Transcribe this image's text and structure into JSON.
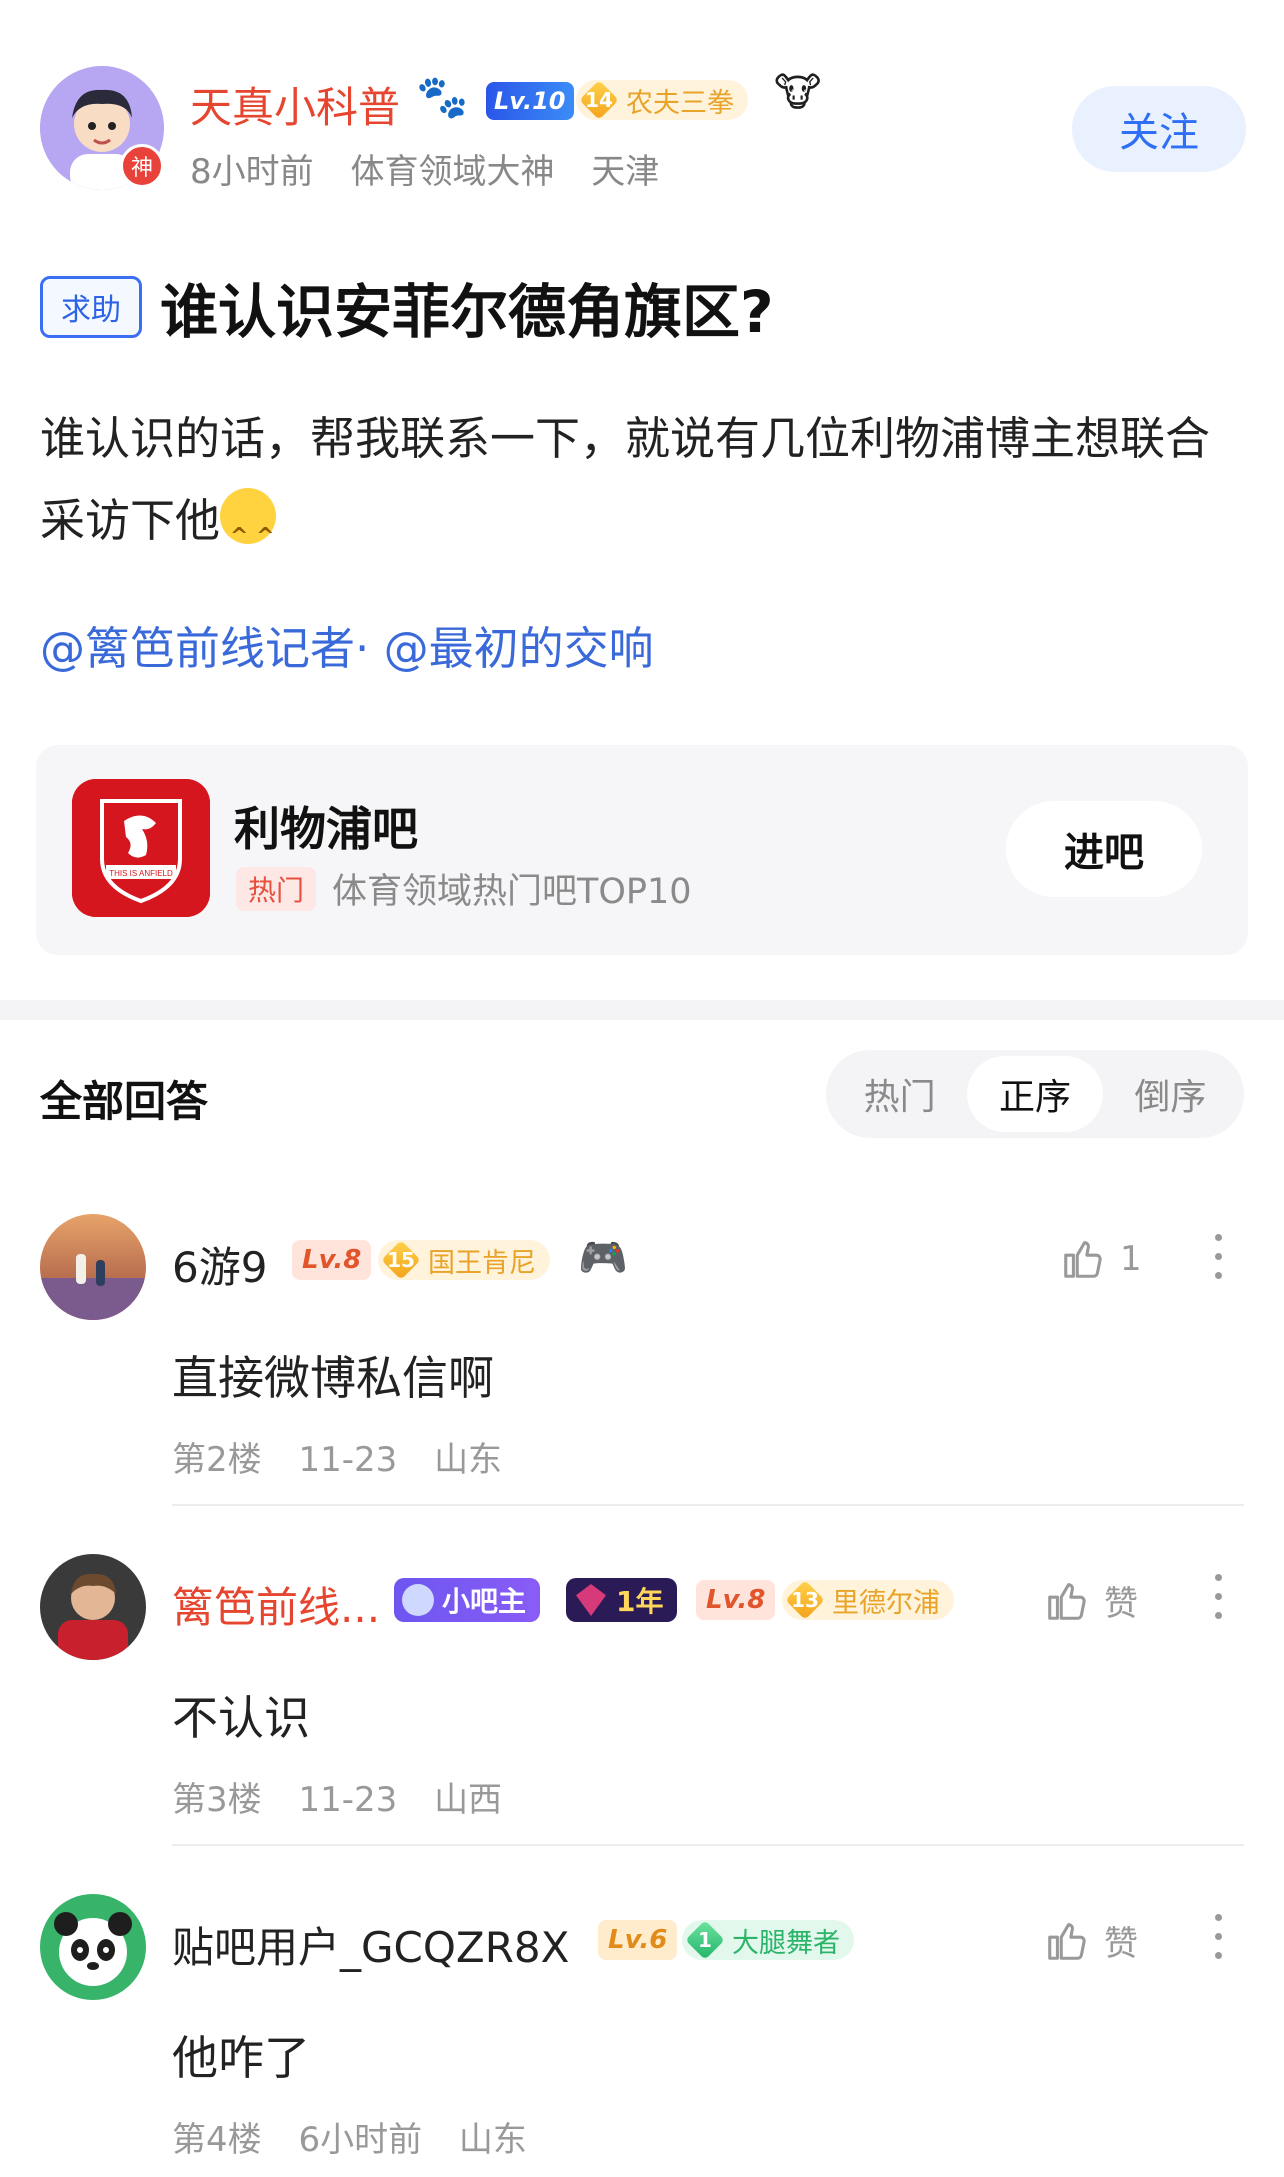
{
  "author": {
    "name": "天真小科普",
    "god_badge": "神",
    "level": "Lv.10",
    "honor": {
      "rank": "14",
      "title": "农夫三拳"
    },
    "meta": [
      "8小时前",
      "体育领域大神",
      "天津"
    ],
    "follow_label": "关注"
  },
  "post": {
    "tag": "求助",
    "title": "谁认识安菲尔德角旗区?",
    "body": "谁认识的话，帮我联系一下，就说有几位利物浦博主想联合采访下他",
    "mentions": "@篱笆前线记者· @最初的交响"
  },
  "forum": {
    "logo_text": "THIS IS ANFIELD",
    "name": "利物浦吧",
    "hot_tag": "热门",
    "desc": "体育领域热门吧TOP10",
    "enter_label": "进吧"
  },
  "answers": {
    "title": "全部回答",
    "sort_tabs": [
      "热门",
      "正序",
      "倒序"
    ],
    "active_sort": "正序"
  },
  "replies": [
    {
      "name": "6游9",
      "level": "Lv.8",
      "honor": {
        "rank": "15",
        "title": "国王肯尼"
      },
      "like": "1",
      "text": "直接微博私信啊",
      "meta": [
        "第2楼",
        "11-23",
        "山东"
      ]
    },
    {
      "name": "篱笆前线...",
      "bazhu": "小吧主",
      "year": "1年",
      "level": "Lv.8",
      "honor": {
        "rank": "13",
        "title": "里德尔浦"
      },
      "like": "赞",
      "text": "不认识",
      "meta": [
        "第3楼",
        "11-23",
        "山西"
      ]
    },
    {
      "name": "贴吧用户_GCQZR8X",
      "level": "Lv.6",
      "honor": {
        "rank": "1",
        "title": "大腿舞者"
      },
      "like": "赞",
      "text": "他咋了",
      "meta": [
        "第4楼",
        "6小时前",
        "山东"
      ]
    }
  ],
  "colors": {
    "accent_blue": "#2f6ff5",
    "name_red": "#e6452f",
    "mention_blue": "#3a6ad9",
    "forum_red": "#d6161f"
  }
}
